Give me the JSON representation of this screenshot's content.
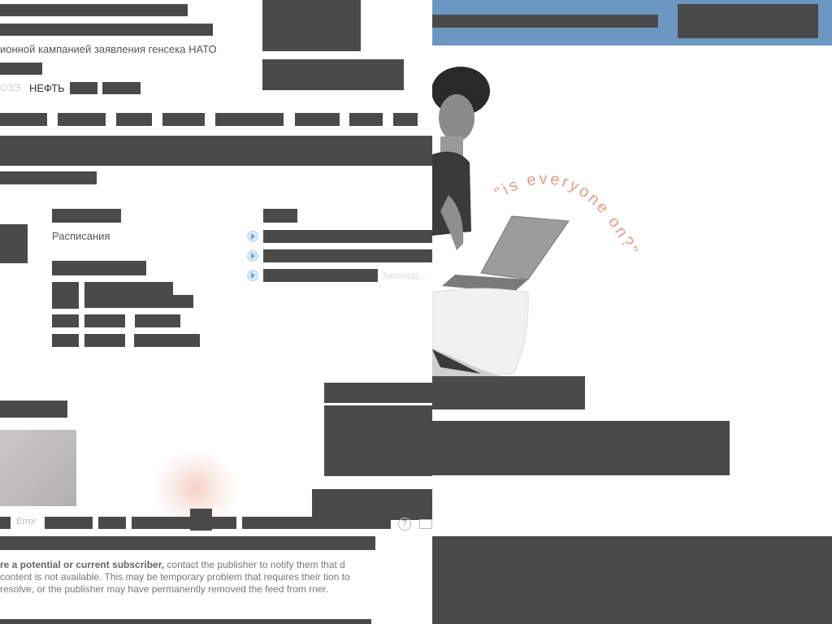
{
  "header": {
    "ticker_text": "ионной кампанией заявления генсека НАТО",
    "market_label_faded": "ОЗЭ",
    "market_label": "НЕФТЬ"
  },
  "main": {
    "schedules_label": "Расписания",
    "link_faded_suffix": "Законод..."
  },
  "footer": {
    "error_label": "Error",
    "notice": {
      "strong": "re a potential or current subscriber,",
      "rest": " contact the publisher to notify them that d content is not available. This may be temporary problem that requires their tion to resolve, or the publisher may have permanently removed the feed from rner."
    }
  },
  "ad": {
    "tagline": "\"is everyone on?\"",
    "colors": {
      "blue_bar": "#6b97c2",
      "tagline": "#e89a85"
    }
  },
  "icons": [
    "play-bullet-icon",
    "help-icon",
    "window-icon"
  ]
}
